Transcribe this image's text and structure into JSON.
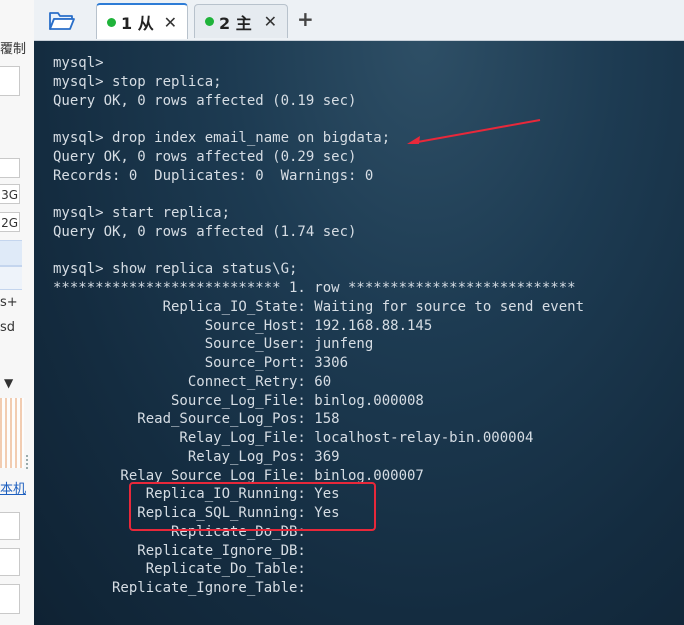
{
  "left_panel": {
    "frag_top": "覆制",
    "frag_3g": "3G",
    "frag_2g": "2G",
    "frag_s_plus": "s+",
    "frag_sd": "sd",
    "frag_arrow": "▼",
    "frag_host": "本机"
  },
  "tabs": [
    {
      "label": "1 从",
      "active": true,
      "status_color": "#1fb33a"
    },
    {
      "label": "2 主",
      "active": false,
      "status_color": "#1fb33a"
    }
  ],
  "toolbar": {
    "close_symbol": "✕",
    "new_tab_symbol": "+"
  },
  "terminal": {
    "lines": [
      "mysql>",
      "mysql> stop replica;",
      "Query OK, 0 rows affected (0.19 sec)",
      "",
      "mysql> drop index email_name on bigdata;",
      "Query OK, 0 rows affected (0.29 sec)",
      "Records: 0  Duplicates: 0  Warnings: 0",
      "",
      "mysql> start replica;",
      "Query OK, 0 rows affected (1.74 sec)",
      "",
      "mysql> show replica status\\G;",
      "*************************** 1. row ***************************",
      "             Replica_IO_State: Waiting for source to send event",
      "                  Source_Host: 192.168.88.145",
      "                  Source_User: junfeng",
      "                  Source_Port: 3306",
      "                Connect_Retry: 60",
      "              Source_Log_File: binlog.000008",
      "          Read_Source_Log_Pos: 158",
      "               Relay_Log_File: localhost-relay-bin.000004",
      "                Relay_Log_Pos: 369",
      "        Relay_Source_Log_File: binlog.000007",
      "           Replica_IO_Running: Yes",
      "          Replica_SQL_Running: Yes",
      "              Replicate_Do_DB:",
      "          Replicate_Ignore_DB:",
      "           Replicate_Do_Table:",
      "       Replicate_Ignore_Table:"
    ]
  },
  "annotations": {
    "highlight_color": "#e8283a"
  }
}
